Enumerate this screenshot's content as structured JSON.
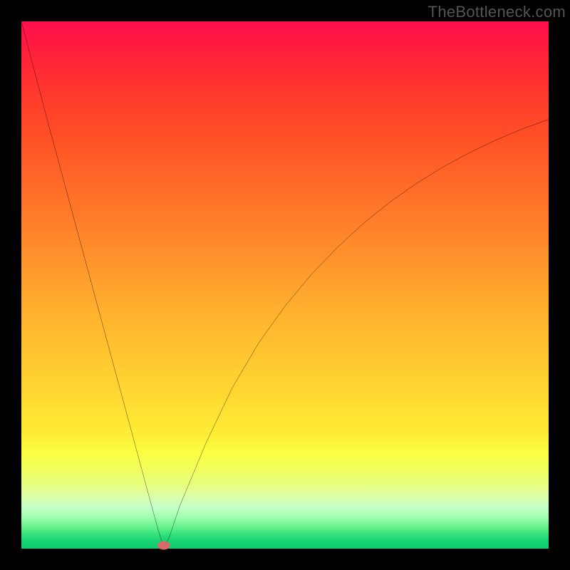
{
  "watermark": "TheBottleneck.com",
  "chart_data": {
    "type": "line",
    "title": "",
    "xlabel": "",
    "ylabel": "",
    "xlim": [
      0,
      100
    ],
    "ylim": [
      0,
      100
    ],
    "curve": {
      "x": [
        0,
        5,
        10,
        15,
        20,
        25,
        26,
        27,
        28,
        30,
        35,
        40,
        45,
        50,
        55,
        60,
        65,
        70,
        75,
        80,
        85,
        90,
        95,
        100
      ],
      "y": [
        100,
        81,
        62.5,
        44,
        25.5,
        7,
        3.4,
        0.2,
        2,
        8,
        20,
        30.5,
        39,
        46,
        52,
        57.2,
        61.8,
        65.8,
        69.3,
        72.4,
        75.1,
        77.5,
        79.6,
        81.4
      ]
    },
    "marker": {
      "x": 27,
      "y": 0.6
    },
    "colors": {
      "curve": "#000000",
      "marker": "#d86a6a",
      "background_top": "#ff0f4d",
      "background_bottom": "#0ecb70",
      "frame": "#000000"
    }
  }
}
